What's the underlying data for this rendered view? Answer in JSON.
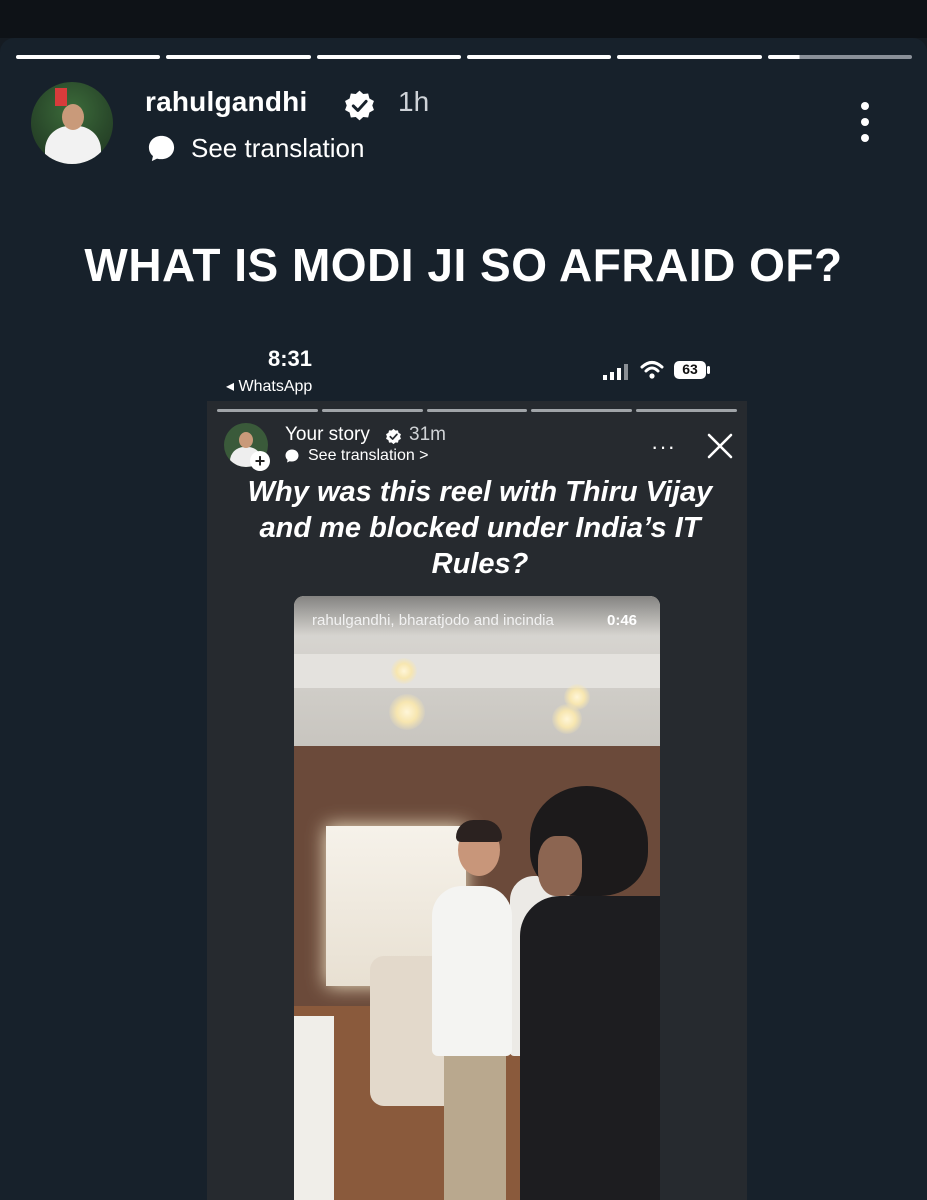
{
  "story": {
    "username": "rahulgandhi",
    "time_ago": "1h",
    "see_translation": "See translation",
    "progress_segments": 6,
    "progress_current_fraction": 0.22,
    "headline": "WHAT IS MODI JI SO AFRAID OF?"
  },
  "embedded": {
    "status_time": "8:31",
    "back_label": "◂ WhatsApp",
    "battery": "63",
    "story_label": "Your story",
    "story_time": "31m",
    "see_translation": "See translation >",
    "more_label": "···",
    "question": "Why was this reel with Thiru Vijay and me blocked under India’s IT Rules?",
    "reel_caption": "rahulgandhi, bharatjodo and incindia",
    "reel_duration": "0:46"
  },
  "colors": {
    "background": "#17212b",
    "verified": "#ffffff",
    "text": "#ffffff"
  },
  "icons": [
    "verified-badge-icon",
    "translate-bubble-icon",
    "more-vertical-icon",
    "close-icon",
    "signal-icon",
    "wifi-icon",
    "battery-icon"
  ]
}
